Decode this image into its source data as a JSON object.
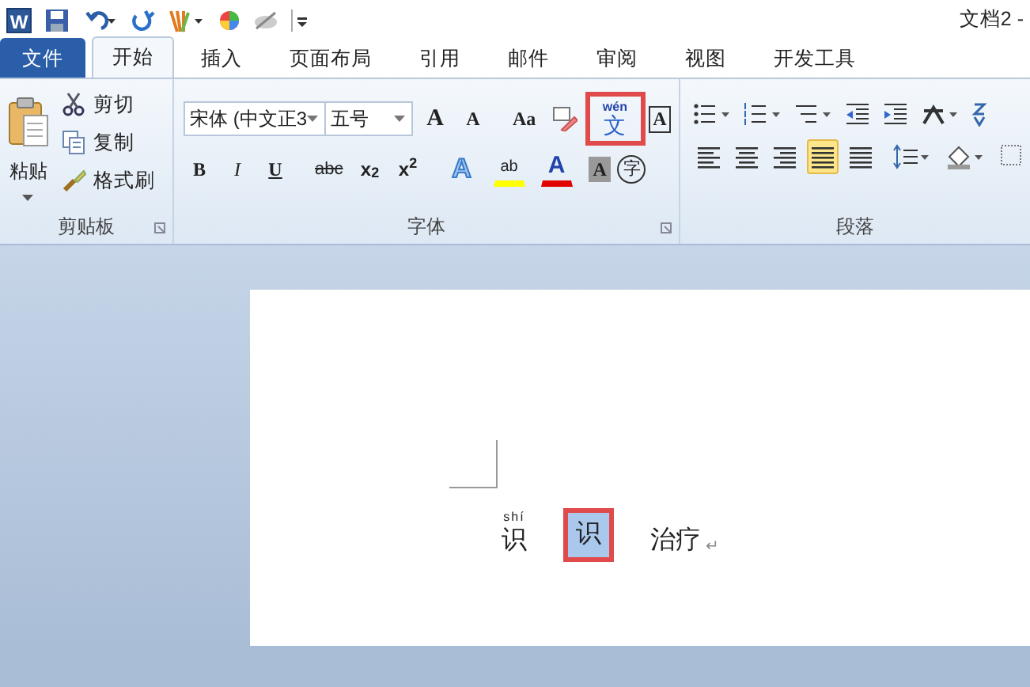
{
  "app_letter": "W",
  "title": "文档2 -",
  "tabs": [
    {
      "label": "文件",
      "selected": false,
      "kind": "file"
    },
    {
      "label": "开始",
      "selected": true,
      "kind": "tab"
    },
    {
      "label": "插入",
      "selected": false,
      "kind": "tab"
    },
    {
      "label": "页面布局",
      "selected": false,
      "kind": "tab"
    },
    {
      "label": "引用",
      "selected": false,
      "kind": "tab"
    },
    {
      "label": "邮件",
      "selected": false,
      "kind": "tab"
    },
    {
      "label": "审阅",
      "selected": false,
      "kind": "tab"
    },
    {
      "label": "视图",
      "selected": false,
      "kind": "tab"
    },
    {
      "label": "开发工具",
      "selected": false,
      "kind": "tab"
    }
  ],
  "clipboard": {
    "paste": "粘贴",
    "items": [
      {
        "kind": "cut",
        "label": "剪切"
      },
      {
        "kind": "copy",
        "label": "复制"
      },
      {
        "kind": "format-painter",
        "label": "格式刷"
      }
    ],
    "label": "剪贴板"
  },
  "font": {
    "name": "宋体 (中文正3",
    "size": "五号",
    "label": "字体",
    "row1": [
      {
        "kind": "grow",
        "text": "A"
      },
      {
        "kind": "shrink",
        "text": "A"
      },
      {
        "kind": "case",
        "text": "Aa"
      },
      {
        "kind": "clear"
      },
      {
        "kind": "phonetic",
        "ruby": "wén",
        "text": "文",
        "highlighted": true
      },
      {
        "kind": "border",
        "text": "A"
      }
    ],
    "row2": [
      {
        "kind": "bold",
        "text": "B"
      },
      {
        "kind": "italic",
        "text": "I"
      },
      {
        "kind": "underline",
        "text": "U"
      },
      {
        "kind": "strike",
        "text": "abc"
      },
      {
        "kind": "sub",
        "text": "x$_{2}$"
      },
      {
        "kind": "sup",
        "text": "x$^{2}$"
      },
      {
        "kind": "effect",
        "text": "A"
      },
      {
        "kind": "highlight",
        "text": "ab"
      },
      {
        "kind": "color",
        "text": "A"
      },
      {
        "kind": "shading",
        "text": "A"
      },
      {
        "kind": "enclose",
        "text": "字"
      }
    ]
  },
  "paragraph": {
    "label": "段落",
    "align": [
      {
        "kind": "left",
        "selected": false
      },
      {
        "kind": "center",
        "selected": false
      },
      {
        "kind": "right",
        "selected": false
      },
      {
        "kind": "justify",
        "selected": true
      },
      {
        "kind": "distributed",
        "selected": false
      }
    ]
  },
  "document": {
    "chars": [
      {
        "text": "识",
        "ruby": "shí",
        "selected": false,
        "highlighted": false
      },
      {
        "text": "识",
        "selected": true,
        "highlighted": true
      },
      {
        "text": "治疗",
        "selected": false,
        "highlighted": false
      }
    ],
    "para_mark": "↵"
  }
}
